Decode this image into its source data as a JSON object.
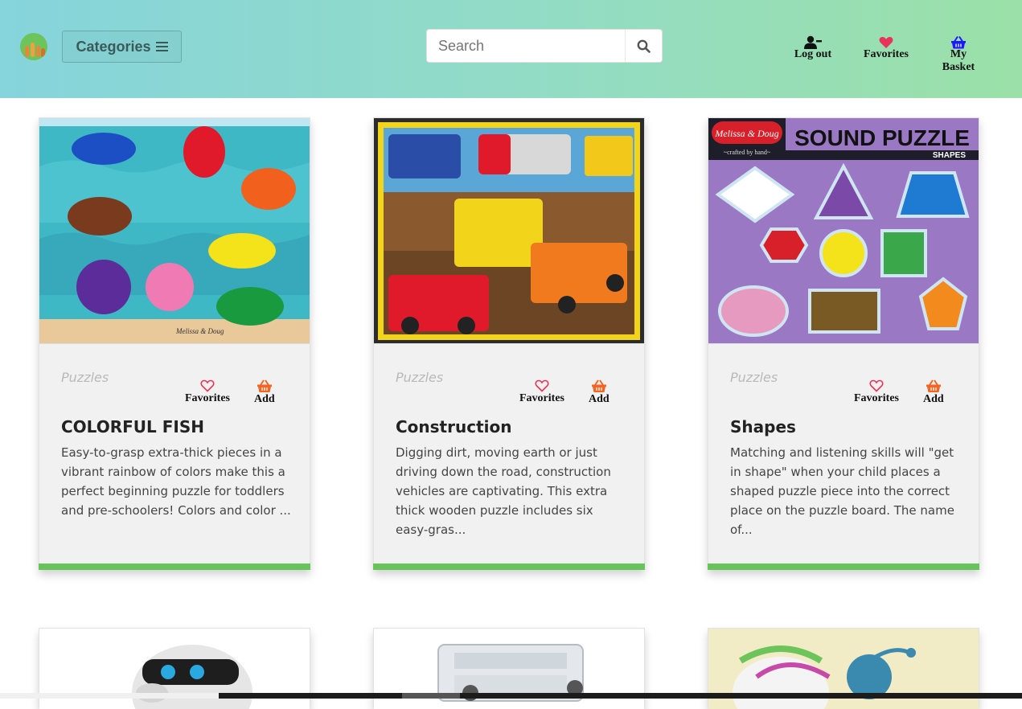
{
  "header": {
    "categories_label": "Categories",
    "search_placeholder": "Search",
    "nav": {
      "logout": "Log out",
      "favorites": "Favorites",
      "basket": "My Basket"
    }
  },
  "products": [
    {
      "category": "Puzzles",
      "favorites_label": "Favorites",
      "add_label": "Add",
      "title": "COLORFUL FISH",
      "description": "Easy-to-grasp extra-thick pieces in a vibrant rainbow of colors make this a perfect beginning puzzle for toddlers and pre-schoolers! Colors and color ..."
    },
    {
      "category": "Puzzles",
      "favorites_label": "Favorites",
      "add_label": "Add",
      "title": "Construction",
      "description": "Digging dirt, moving earth or just driving down the road, construction vehicles are captivating. This extra thick wooden puzzle includes six easy-gras..."
    },
    {
      "category": "Puzzles",
      "favorites_label": "Favorites",
      "add_label": "Add",
      "title": "Shapes",
      "description": "Matching and listening skills will \"get in shape\" when your child places a shaped puzzle piece into the correct place on the puzzle board. The name of..."
    }
  ],
  "shapes_image": {
    "brand": "Melissa & Doug",
    "brand_sub": "~crafted by hand~",
    "title": "SOUND PUZZLE",
    "sub": "SHAPES"
  },
  "fish_image": {
    "brand": "Melissa & Doug"
  },
  "colors": {
    "accent_green": "#66c45a",
    "fav_heart": "#e8335a",
    "add_basket": "#f26522",
    "nav_basket": "#1a1aff"
  }
}
